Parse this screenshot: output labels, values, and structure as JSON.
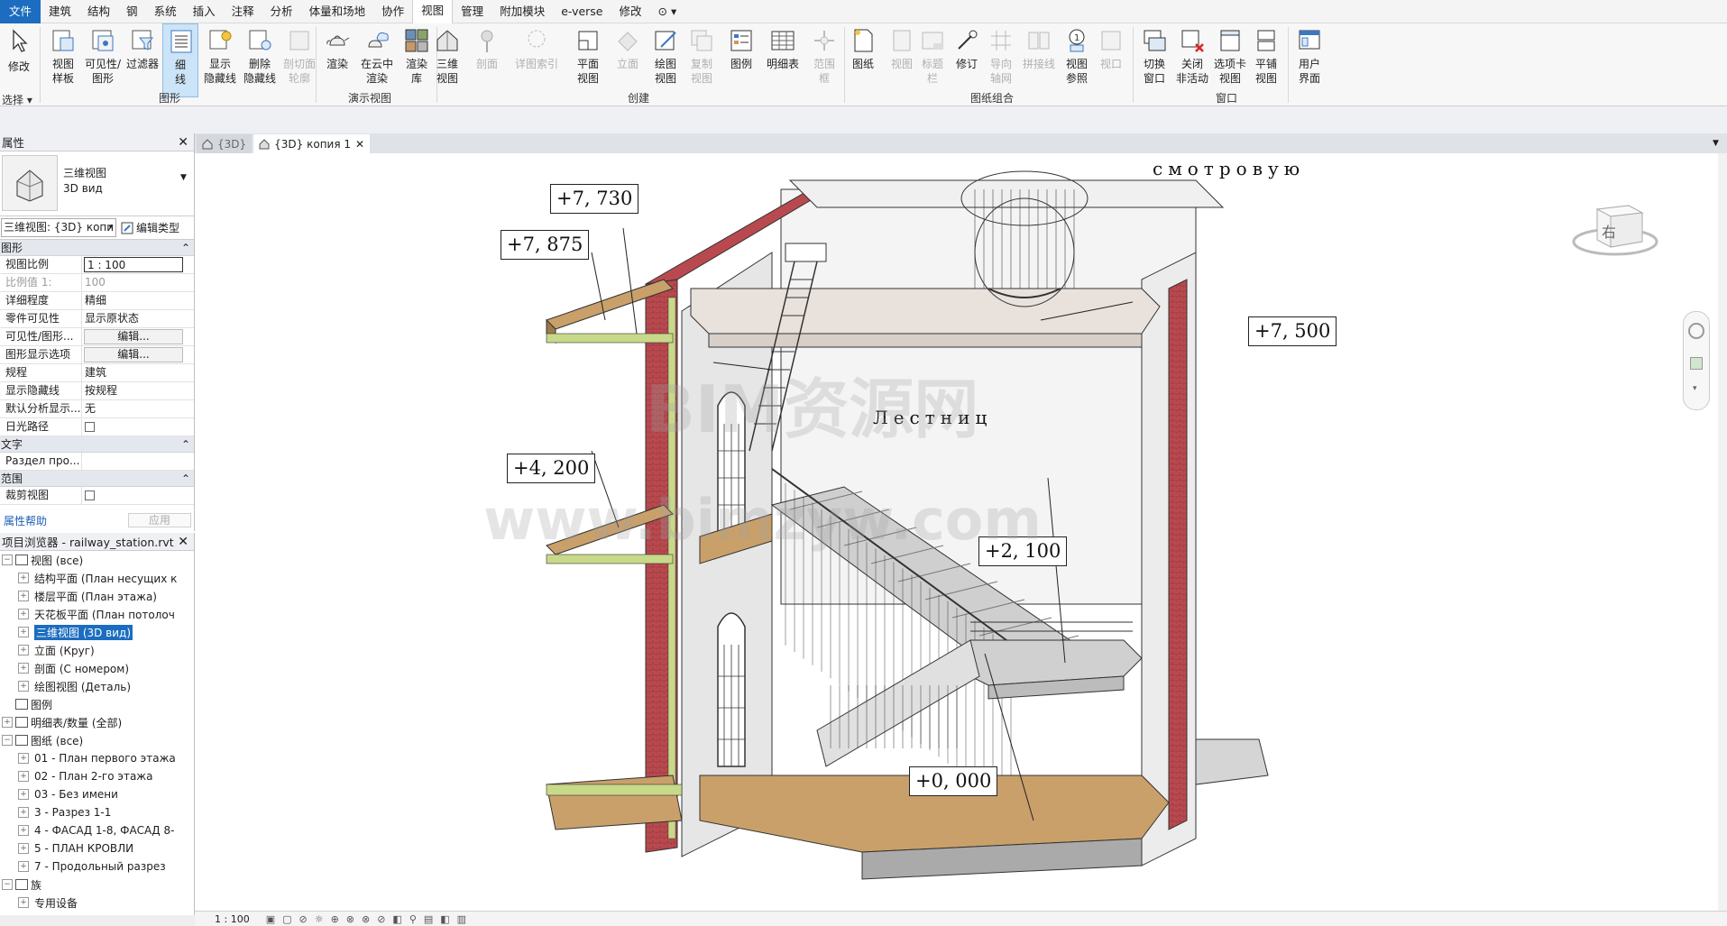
{
  "menubar": {
    "file": "文件",
    "items": [
      "建筑",
      "结构",
      "钢",
      "系统",
      "插入",
      "注释",
      "分析",
      "体量和场地",
      "协作",
      "视图",
      "管理",
      "附加模块",
      "e-verse",
      "修改"
    ],
    "active": "视图",
    "extra": "⊙ ▾"
  },
  "ribbon": {
    "modify": "修改",
    "select": "选择 ▾",
    "buttons": [
      {
        "id": "view-template",
        "label": "视图\n样板"
      },
      {
        "id": "visibility-graphics",
        "label": "可见性/\n图形"
      },
      {
        "id": "filters",
        "label": "过滤器"
      },
      {
        "id": "thin-lines",
        "label": "细\n线"
      },
      {
        "id": "show-hidden",
        "label": "显示\n隐藏线"
      },
      {
        "id": "remove-hidden",
        "label": "删除\n隐藏线"
      },
      {
        "id": "cut-profile",
        "label": "剖切面\n轮廓"
      },
      {
        "id": "render",
        "label": "渲染"
      },
      {
        "id": "render-cloud",
        "label": "在云中\n渲染"
      },
      {
        "id": "render-gallery",
        "label": "渲染\n库"
      },
      {
        "id": "3d-view",
        "label": "三维\n视图"
      },
      {
        "id": "section",
        "label": "剖面"
      },
      {
        "id": "callout",
        "label": "详图索引"
      },
      {
        "id": "plan-views",
        "label": "平面\n视图"
      },
      {
        "id": "elevation",
        "label": "立面"
      },
      {
        "id": "drafting-view",
        "label": "绘图\n视图"
      },
      {
        "id": "duplicate-view",
        "label": "复制\n视图"
      },
      {
        "id": "legends",
        "label": "图例"
      },
      {
        "id": "schedules",
        "label": "明细表"
      },
      {
        "id": "scope-box",
        "label": "范围\n框"
      },
      {
        "id": "sheet",
        "label": "图纸"
      },
      {
        "id": "view",
        "label": "视图"
      },
      {
        "id": "title-block",
        "label": "标题\n栏"
      },
      {
        "id": "revisions",
        "label": "修订"
      },
      {
        "id": "guide-grid",
        "label": "导向\n轴网"
      },
      {
        "id": "matchline",
        "label": "拼接线"
      },
      {
        "id": "view-reference",
        "label": "视图\n参照"
      },
      {
        "id": "viewports",
        "label": "视口"
      },
      {
        "id": "switch-windows",
        "label": "切换\n窗口"
      },
      {
        "id": "close-inactive",
        "label": "关闭\n非活动"
      },
      {
        "id": "tab-views",
        "label": "选项卡\n视图"
      },
      {
        "id": "tile-views",
        "label": "平铺\n视图"
      },
      {
        "id": "user-interface",
        "label": "用户\n界面"
      }
    ],
    "groups": [
      "图形",
      "演示视图",
      "创建",
      "图纸组合",
      "窗口"
    ]
  },
  "properties": {
    "title": "属性",
    "type_name": "三维视图",
    "type_sub": "3D вид",
    "view_selector": "三维视图: {3D} копи",
    "edit_type": "编辑类型",
    "sections": {
      "graphics": "图形",
      "text": "文字",
      "extents": "范围"
    },
    "rows": [
      {
        "k": "视图比例",
        "v": "1 : 100"
      },
      {
        "k": "比例值 1:",
        "v": "100"
      },
      {
        "k": "详细程度",
        "v": "精细"
      },
      {
        "k": "零件可见性",
        "v": "显示原状态"
      },
      {
        "k": "可见性/图形...",
        "v": "编辑..."
      },
      {
        "k": "图形显示选项",
        "v": "编辑..."
      },
      {
        "k": "规程",
        "v": "建筑"
      },
      {
        "k": "显示隐藏线",
        "v": "按规程"
      },
      {
        "k": "默认分析显示...",
        "v": "无"
      },
      {
        "k": "日光路径",
        "v": ""
      }
    ],
    "text_row": {
      "k": "Раздел про...",
      "v": ""
    },
    "extents_row": {
      "k": "裁剪视图",
      "v": ""
    },
    "help": "属性帮助",
    "apply": "应用"
  },
  "browser": {
    "title": "项目浏览器 - railway_station.rvt",
    "items": [
      {
        "t": "视图 (все)",
        "lvl": 0,
        "tw": "⊟"
      },
      {
        "t": "结构平面 (План несущих к",
        "lvl": 1,
        "tw": "⊞"
      },
      {
        "t": "楼层平面 (План этажа)",
        "lvl": 1,
        "tw": "⊞"
      },
      {
        "t": "天花板平面 (План потолоч",
        "lvl": 1,
        "tw": "⊞"
      },
      {
        "t": "三维视图 (3D вид)",
        "lvl": 1,
        "tw": "⊞",
        "sel": true
      },
      {
        "t": "立面 (Круг)",
        "lvl": 1,
        "tw": "⊞"
      },
      {
        "t": "剖面 (С номером)",
        "lvl": 1,
        "tw": "⊞"
      },
      {
        "t": "绘图视图 (Деталь)",
        "lvl": 1,
        "tw": "⊞"
      },
      {
        "t": "图例",
        "lvl": 0,
        "tw": ""
      },
      {
        "t": "明细表/数量 (全部)",
        "lvl": 0,
        "tw": "⊞"
      },
      {
        "t": "图纸 (все)",
        "lvl": 0,
        "tw": "⊟"
      },
      {
        "t": "01 - План первого этажа",
        "lvl": 1,
        "tw": "⊞"
      },
      {
        "t": "02 - План 2-го этажа",
        "lvl": 1,
        "tw": "⊞"
      },
      {
        "t": "03 - Без имени",
        "lvl": 1,
        "tw": "⊞"
      },
      {
        "t": "3 - Разрез 1-1",
        "lvl": 1,
        "tw": "⊞"
      },
      {
        "t": "4 - ФАСАД 1-8, ФАСАД 8-",
        "lvl": 1,
        "tw": "⊞"
      },
      {
        "t": "5 - ПЛАН КРОВЛИ",
        "lvl": 1,
        "tw": "⊞"
      },
      {
        "t": "7 - Продольный разрез",
        "lvl": 1,
        "tw": "⊞"
      },
      {
        "t": "族",
        "lvl": 0,
        "tw": "⊟"
      },
      {
        "t": "专用设备",
        "lvl": 1,
        "tw": "⊞"
      }
    ]
  },
  "tabs": [
    {
      "label": "{3D}",
      "active": false
    },
    {
      "label": "{3D} копия 1",
      "active": true
    }
  ],
  "canvas": {
    "elevations": [
      "+7, 730",
      "+7, 875",
      "+7, 500",
      "+4, 200",
      "+2, 100",
      "+0, 000"
    ],
    "notes": [
      "смотровую",
      "Лестниц"
    ],
    "watermark": [
      "BIM资源网",
      "www.bimzyw.com"
    ],
    "viewcube_face": "右"
  },
  "status": {
    "scale": "1 : 100"
  },
  "colors": {
    "accent": "#1c6dbf",
    "wall_red": "#b84a4f",
    "floor_wood": "#c9a06a",
    "insulation": "#c8d98a"
  }
}
